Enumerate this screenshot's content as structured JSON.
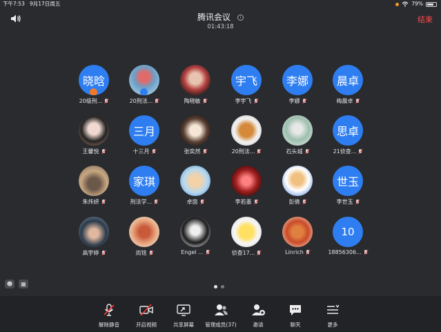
{
  "status_bar": {
    "time": "下午7:53",
    "date": "9月17日周五",
    "battery": "79%",
    "battery_level": 0.79
  },
  "header": {
    "title": "腾讯会议",
    "timer": "01:43:18",
    "end_label": "结束",
    "accent_red": "#ff4a4a"
  },
  "participants": [
    {
      "avatar_text": "晓晗",
      "name": "20级刑..."
    },
    {
      "avatar_text": "",
      "name": "20刑法..."
    },
    {
      "avatar_text": "",
      "name": "陶晓敏"
    },
    {
      "avatar_text": "宇飞",
      "name": "李宇飞"
    },
    {
      "avatar_text": "李娜",
      "name": "李娜"
    },
    {
      "avatar_text": "晨卓",
      "name": "梅晨卓"
    },
    {
      "avatar_text": "",
      "name": "王馨悦"
    },
    {
      "avatar_text": "三月",
      "name": "十三月"
    },
    {
      "avatar_text": "",
      "name": "张奕然"
    },
    {
      "avatar_text": "",
      "name": "20刑法..."
    },
    {
      "avatar_text": "",
      "name": "石头城"
    },
    {
      "avatar_text": "思卓",
      "name": "21侦查..."
    },
    {
      "avatar_text": "",
      "name": "朱炜妍"
    },
    {
      "avatar_text": "家琪",
      "name": "刑法学..."
    },
    {
      "avatar_text": "",
      "name": "卓茵"
    },
    {
      "avatar_text": "",
      "name": "李若墨"
    },
    {
      "avatar_text": "",
      "name": "彭倩"
    },
    {
      "avatar_text": "世玉",
      "name": "李世玉"
    },
    {
      "avatar_text": "",
      "name": "高宇婷"
    },
    {
      "avatar_text": "",
      "name": "尚铭"
    },
    {
      "avatar_text": "",
      "name": "Engel ..."
    },
    {
      "avatar_text": "",
      "name": "侦查17..."
    },
    {
      "avatar_text": "",
      "name": "Linrich"
    },
    {
      "avatar_text": "10",
      "name": "18856306..."
    }
  ],
  "toolbar": {
    "unmute": "解除静音",
    "start_video": "开启视频",
    "share_screen": "共享屏幕",
    "manage_members": "管理成员(37)",
    "invite": "邀请",
    "chat": "聊天",
    "more": "更多"
  },
  "colors": {
    "background": "#2a2b2f",
    "avatar_blue": "#2e7ef2",
    "toolbar_bg": "#222326"
  }
}
